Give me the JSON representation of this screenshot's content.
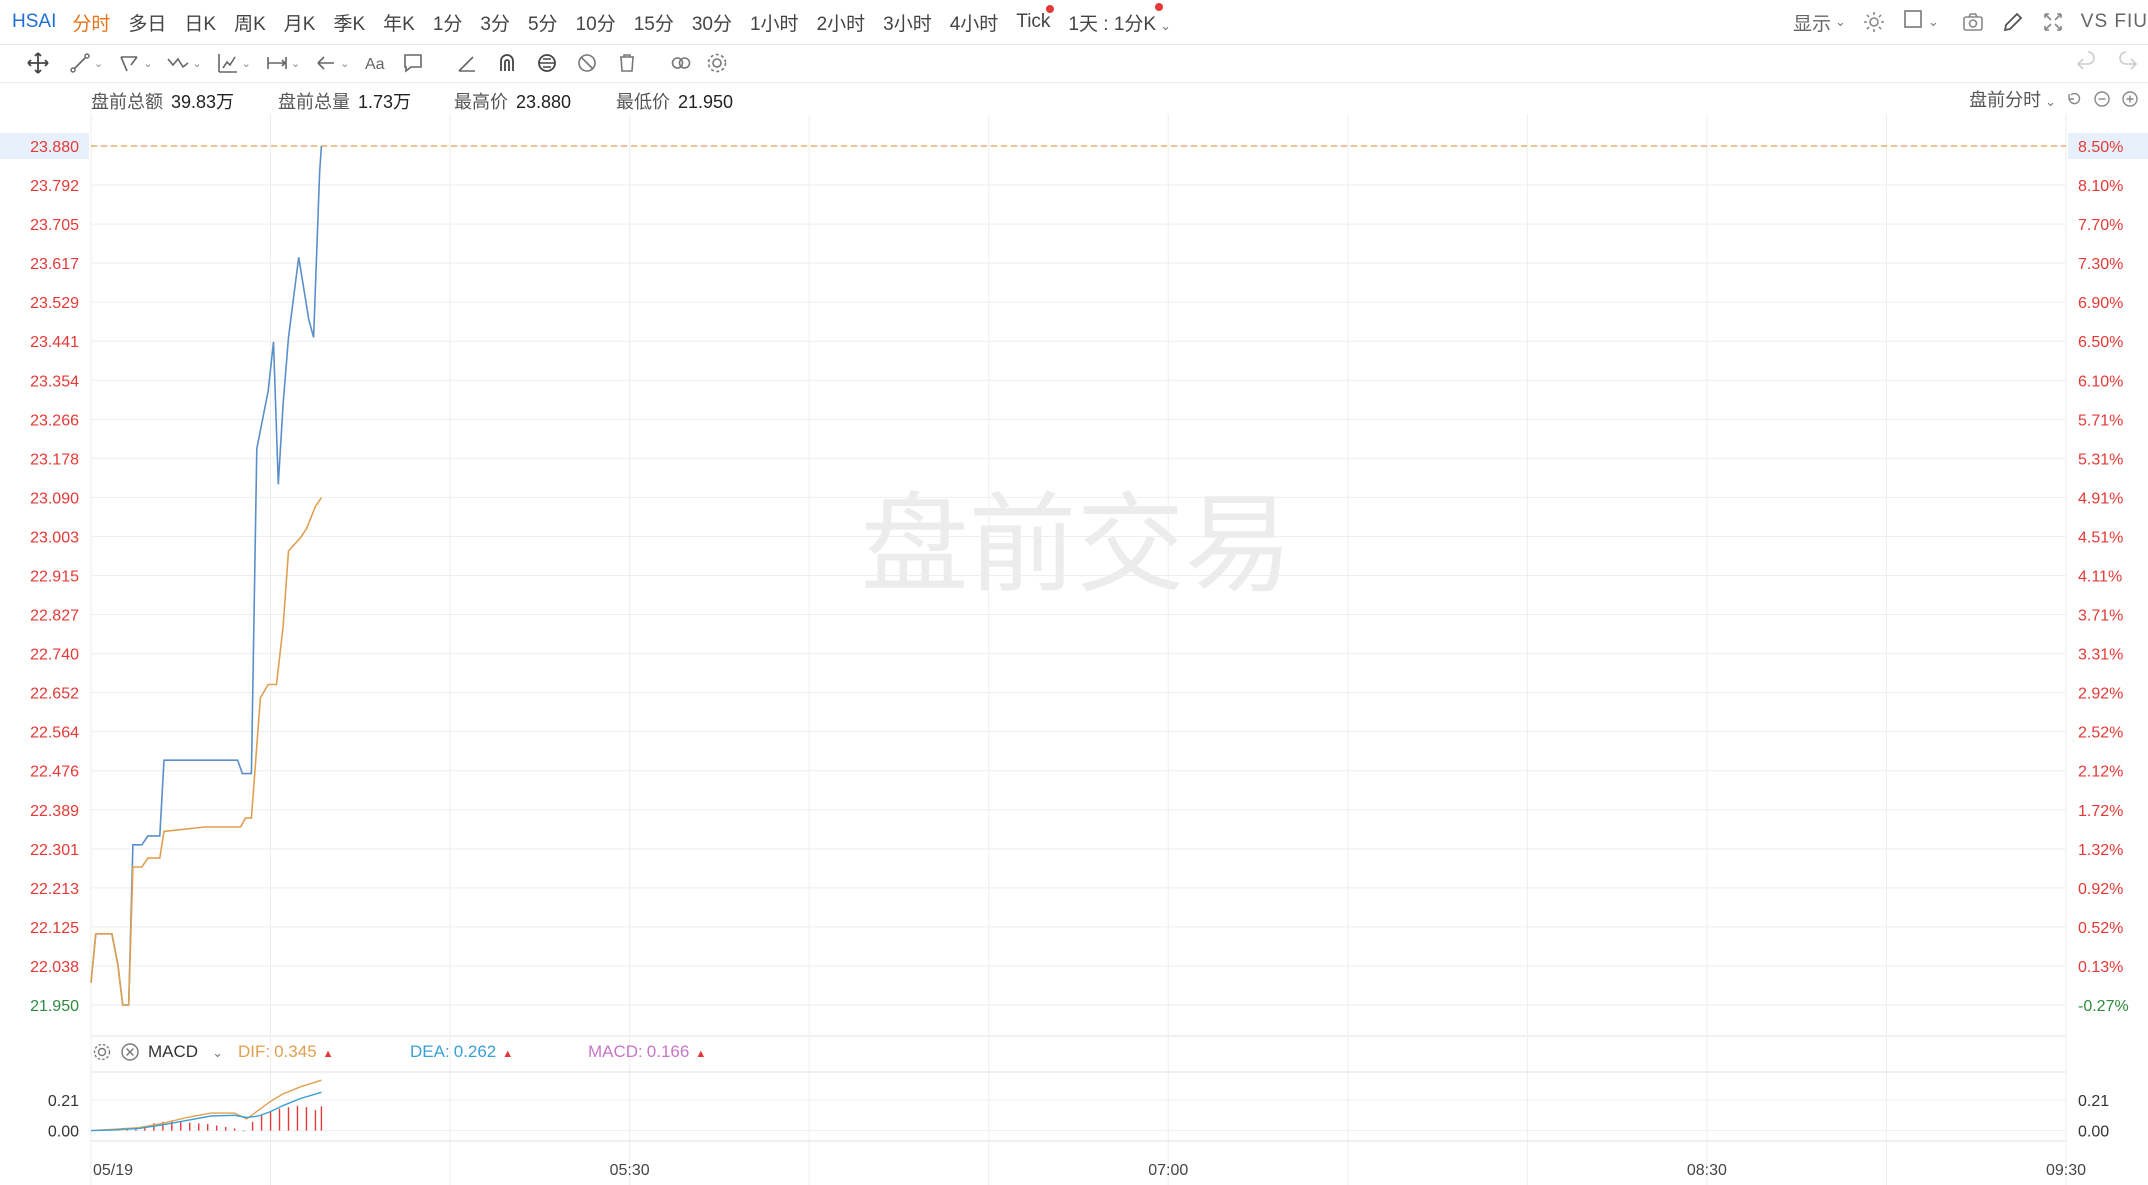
{
  "header": {
    "symbol": "HSAI",
    "periods": [
      {
        "label": "分时",
        "active": true,
        "dot": false
      },
      {
        "label": "多日",
        "active": false,
        "dot": false
      },
      {
        "label": "日K",
        "active": false,
        "dot": false
      },
      {
        "label": "周K",
        "active": false,
        "dot": false
      },
      {
        "label": "月K",
        "active": false,
        "dot": false
      },
      {
        "label": "季K",
        "active": false,
        "dot": false
      },
      {
        "label": "年K",
        "active": false,
        "dot": false
      },
      {
        "label": "1分",
        "active": false,
        "dot": false
      },
      {
        "label": "3分",
        "active": false,
        "dot": false
      },
      {
        "label": "5分",
        "active": false,
        "dot": false
      },
      {
        "label": "10分",
        "active": false,
        "dot": false
      },
      {
        "label": "15分",
        "active": false,
        "dot": false
      },
      {
        "label": "30分",
        "active": false,
        "dot": false
      },
      {
        "label": "1小时",
        "active": false,
        "dot": false
      },
      {
        "label": "2小时",
        "active": false,
        "dot": false
      },
      {
        "label": "3小时",
        "active": false,
        "dot": false
      },
      {
        "label": "4小时",
        "active": false,
        "dot": false
      },
      {
        "label": "Tick",
        "active": false,
        "dot": true
      }
    ],
    "combo_label": "1天 : 1分K",
    "display_label": "显示",
    "compare_label": "VS FIU"
  },
  "toolbar": {
    "left_tools": [
      "move-icon",
      "line-icon",
      "fork-icon",
      "wave-icon",
      "measure-icon",
      "range-icon",
      "arrow-left-icon",
      "text-icon",
      "comment-icon",
      "angle-icon",
      "magnet-icon",
      "lock-icon",
      "hide-icon",
      "trash-icon",
      "link-icon",
      "settings-icon"
    ],
    "right_tools": [
      "undo-icon",
      "redo-icon"
    ]
  },
  "info": {
    "turnover_label": "盘前总额",
    "turnover_value": "39.83万",
    "volume_label": "盘前总量",
    "volume_value": "1.73万",
    "high_label": "最高价",
    "high_value": "23.880",
    "low_label": "最低价",
    "low_value": "21.950",
    "session_label": "盘前分时"
  },
  "watermark": "盘前交易",
  "chart_data": {
    "type": "line",
    "session": "pre-market",
    "y_ticks": [
      "23.880",
      "23.792",
      "23.705",
      "23.617",
      "23.529",
      "23.441",
      "23.354",
      "23.266",
      "23.178",
      "23.090",
      "23.003",
      "22.915",
      "22.827",
      "22.740",
      "22.652",
      "22.564",
      "22.476",
      "22.389",
      "22.301",
      "22.213",
      "22.125",
      "22.038",
      "21.950"
    ],
    "pct_ticks": [
      "8.50%",
      "8.10%",
      "7.70%",
      "7.30%",
      "6.90%",
      "6.50%",
      "6.10%",
      "5.71%",
      "5.31%",
      "4.91%",
      "4.51%",
      "4.11%",
      "3.71%",
      "3.31%",
      "2.92%",
      "2.52%",
      "2.12%",
      "1.72%",
      "1.32%",
      "0.92%",
      "0.52%",
      "0.13%",
      "-0.27%"
    ],
    "ylim": [
      21.95,
      23.88
    ],
    "x_labels": [
      "05/19",
      "05:30",
      "07:00",
      "08:30",
      "09:30"
    ],
    "x_minutes": [
      240,
      330,
      420,
      510,
      570
    ],
    "xlim": [
      240,
      570
    ],
    "high_line": 23.88,
    "series": [
      {
        "color": "#5b8fc9",
        "points": [
          [
            240,
            22.0
          ],
          [
            240.8,
            22.11
          ],
          [
            243.5,
            22.11
          ],
          [
            244.5,
            22.04
          ],
          [
            245.3,
            21.95
          ],
          [
            246.3,
            21.95
          ],
          [
            247,
            22.31
          ],
          [
            248.5,
            22.31
          ],
          [
            249.5,
            22.33
          ],
          [
            251.5,
            22.33
          ],
          [
            252.2,
            22.5
          ],
          [
            259,
            22.5
          ],
          [
            264.5,
            22.5
          ],
          [
            265.3,
            22.47
          ],
          [
            266.8,
            22.47
          ],
          [
            267.7,
            23.2
          ],
          [
            269.6,
            23.33
          ],
          [
            270.5,
            23.44
          ],
          [
            271.3,
            23.12
          ],
          [
            272.1,
            23.3
          ],
          [
            273,
            23.45
          ],
          [
            274.7,
            23.63
          ],
          [
            276.4,
            23.49
          ],
          [
            277.2,
            23.45
          ],
          [
            278.2,
            23.82
          ],
          [
            278.5,
            23.88
          ]
        ]
      },
      {
        "color": "#e0a050",
        "points": [
          [
            240,
            22.0
          ],
          [
            240.8,
            22.11
          ],
          [
            243.5,
            22.11
          ],
          [
            244.5,
            22.04
          ],
          [
            245.3,
            21.95
          ],
          [
            246.3,
            21.95
          ],
          [
            247,
            22.26
          ],
          [
            248.5,
            22.26
          ],
          [
            249.5,
            22.28
          ],
          [
            251.5,
            22.28
          ],
          [
            252.2,
            22.34
          ],
          [
            259,
            22.35
          ],
          [
            265,
            22.35
          ],
          [
            265.8,
            22.37
          ],
          [
            266.8,
            22.37
          ],
          [
            268.3,
            22.64
          ],
          [
            269.6,
            22.67
          ],
          [
            271,
            22.67
          ],
          [
            272.1,
            22.8
          ],
          [
            273,
            22.97
          ],
          [
            275,
            23.0
          ],
          [
            276,
            23.02
          ],
          [
            277.5,
            23.07
          ],
          [
            278.5,
            23.09
          ]
        ]
      }
    ]
  },
  "macd": {
    "name": "MACD",
    "dif_label": "DIF:",
    "dif_value": "0.345",
    "dif_color": "#e0a050",
    "dea_label": "DEA:",
    "dea_value": "0.262",
    "dea_color": "#3aa0d6",
    "macd_label": "MACD:",
    "macd_value": "0.166",
    "macd_color": "#c776c9",
    "y_ticks": [
      "0.21",
      "0.00"
    ],
    "ylim": [
      -0.03,
      0.36
    ],
    "dif_points": [
      [
        240,
        0.0
      ],
      [
        244,
        0.01
      ],
      [
        248,
        0.02
      ],
      [
        252,
        0.05
      ],
      [
        256,
        0.09
      ],
      [
        260,
        0.12
      ],
      [
        264,
        0.12
      ],
      [
        266,
        0.08
      ],
      [
        268,
        0.14
      ],
      [
        270,
        0.2
      ],
      [
        272,
        0.25
      ],
      [
        275,
        0.3
      ],
      [
        278.5,
        0.345
      ]
    ],
    "dea_points": [
      [
        240,
        0.0
      ],
      [
        244,
        0.005
      ],
      [
        248,
        0.015
      ],
      [
        252,
        0.04
      ],
      [
        256,
        0.07
      ],
      [
        260,
        0.1
      ],
      [
        264,
        0.105
      ],
      [
        266,
        0.09
      ],
      [
        268,
        0.1
      ],
      [
        270,
        0.13
      ],
      [
        272,
        0.17
      ],
      [
        275,
        0.22
      ],
      [
        278.5,
        0.262
      ]
    ],
    "hist": [
      [
        241.5,
        0.005
      ],
      [
        243,
        0.008
      ],
      [
        244.5,
        0.01
      ],
      [
        246,
        0.012
      ],
      [
        247.5,
        0.015
      ],
      [
        249,
        0.03
      ],
      [
        250.5,
        0.05
      ],
      [
        252,
        0.06
      ],
      [
        253.5,
        0.07
      ],
      [
        255,
        0.06
      ],
      [
        256.5,
        0.055
      ],
      [
        258,
        0.05
      ],
      [
        259.5,
        0.045
      ],
      [
        261,
        0.035
      ],
      [
        262.5,
        0.025
      ],
      [
        264,
        0.015
      ],
      [
        265.5,
        -0.005
      ],
      [
        267,
        0.06
      ],
      [
        268.5,
        0.11
      ],
      [
        270,
        0.13
      ],
      [
        271.5,
        0.15
      ],
      [
        273,
        0.16
      ],
      [
        274.5,
        0.17
      ],
      [
        276,
        0.16
      ],
      [
        277.5,
        0.14
      ],
      [
        278.5,
        0.166
      ]
    ]
  },
  "colors": {
    "up": "#e53935",
    "down": "#2e8b3e",
    "grid": "#eeeeee",
    "high_line": "#e0a050",
    "axis_text": "#555555"
  }
}
